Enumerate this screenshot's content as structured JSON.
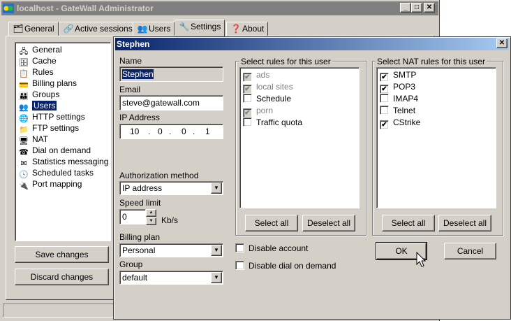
{
  "main_window": {
    "title": "localhost - GateWall Administrator",
    "tabs": [
      {
        "label": "General",
        "icon": "general-tab-icon"
      },
      {
        "label": "Active sessions",
        "icon": "active-sessions-icon"
      },
      {
        "label": "Users",
        "icon": "users-icon"
      },
      {
        "label": "Settings",
        "icon": "settings-icon",
        "active": true
      },
      {
        "label": "About",
        "icon": "about-icon"
      }
    ],
    "nav_items": [
      {
        "label": "General",
        "icon": "network-icon"
      },
      {
        "label": "Cache",
        "icon": "cache-icon"
      },
      {
        "label": "Rules",
        "icon": "rules-icon"
      },
      {
        "label": "Billing plans",
        "icon": "billing-icon"
      },
      {
        "label": "Groups",
        "icon": "groups-icon"
      },
      {
        "label": "Users",
        "icon": "users-icon",
        "selected": true
      },
      {
        "label": "HTTP settings",
        "icon": "http-icon"
      },
      {
        "label": "FTP settings",
        "icon": "ftp-icon"
      },
      {
        "label": "NAT",
        "icon": "nat-icon"
      },
      {
        "label": "Dial on demand",
        "icon": "dial-icon"
      },
      {
        "label": "Statistics messaging",
        "icon": "mail-icon"
      },
      {
        "label": "Scheduled tasks",
        "icon": "clock-icon"
      },
      {
        "label": "Port mapping",
        "icon": "port-icon"
      }
    ],
    "save_label": "Save changes",
    "discard_label": "Discard changes"
  },
  "dialog": {
    "title": "Stephen",
    "name_label": "Name",
    "name_value": "Stephen",
    "email_label": "Email",
    "email_value": "steve@gatewall.com",
    "ip_label": "IP Address",
    "ip": [
      "10",
      "0",
      "0",
      "1"
    ],
    "ip_dot": ".",
    "auth_label": "Authorization method",
    "auth_value": "IP address",
    "speed_label": "Speed limit",
    "speed_value": "0",
    "speed_unit": "Kb/s",
    "billing_label": "Billing plan",
    "billing_value": "Personal",
    "group_label": "Group",
    "group_value": "default",
    "rules_group_label": "Select rules for this user",
    "rules": [
      {
        "label": "ads",
        "checked": true,
        "disabled": true
      },
      {
        "label": "local sites",
        "checked": true,
        "disabled": true
      },
      {
        "label": "Schedule",
        "checked": false,
        "disabled": false
      },
      {
        "label": "porn",
        "checked": true,
        "disabled": true
      },
      {
        "label": "Traffic quota",
        "checked": false,
        "disabled": false
      }
    ],
    "nat_group_label": "Select NAT rules for this user",
    "nat_rules": [
      {
        "label": "SMTP",
        "checked": true
      },
      {
        "label": "POP3",
        "checked": true
      },
      {
        "label": "IMAP4",
        "checked": false
      },
      {
        "label": "Telnet",
        "checked": false
      },
      {
        "label": "CStrike",
        "checked": true
      }
    ],
    "select_all_label": "Select all",
    "deselect_all_label": "Deselect all",
    "disable_account_label": "Disable account",
    "disable_dial_label": "Disable dial on demand",
    "disable_account_checked": false,
    "disable_dial_checked": false,
    "ok_label": "OK",
    "cancel_label": "Cancel",
    "check_mark": "✔"
  },
  "colors": {
    "title_inactive": "#808080",
    "title_active_start": "#0a246a",
    "title_active_end": "#a6caf0",
    "face": "#d4d0c8",
    "selection": "#0a246a"
  }
}
